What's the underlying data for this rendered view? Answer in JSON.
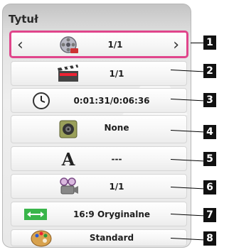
{
  "panel": {
    "title": "Tytuł"
  },
  "rows": [
    {
      "icon": "title-reel-icon",
      "value": "1/1"
    },
    {
      "icon": "clapperboard-icon",
      "value": "1/1"
    },
    {
      "icon": "clock-icon",
      "value": "0:01:31/0:06:36"
    },
    {
      "icon": "speaker-icon",
      "value": "None"
    },
    {
      "icon": "subtitle-letter-a-icon",
      "value": "---"
    },
    {
      "icon": "camera-angle-icon",
      "value": "1/1"
    },
    {
      "icon": "aspect-ratio-icon",
      "value": "16:9 Oryginalne"
    },
    {
      "icon": "palette-icon",
      "value": "Standard"
    }
  ],
  "arrows": {
    "left": "‹",
    "right": "›"
  },
  "callouts": [
    "1",
    "2",
    "3",
    "4",
    "5",
    "6",
    "7",
    "8"
  ],
  "colors": {
    "selection": "#e0458b",
    "badge": "#111111"
  }
}
